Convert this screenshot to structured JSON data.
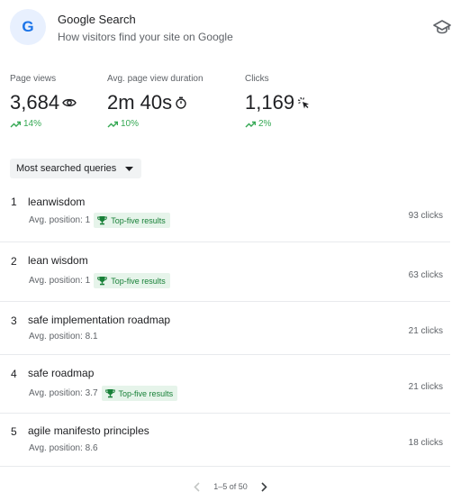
{
  "header": {
    "logo_letter": "G",
    "title": "Google Search",
    "subtitle": "How visitors find your site on Google",
    "learn_icon": "graduation-cap-icon"
  },
  "metrics": [
    {
      "label": "Page views",
      "value": "3,684",
      "icon": "eye-icon",
      "change": "14%",
      "trend": "up"
    },
    {
      "label": "Avg. page view duration",
      "value": "2m 40s",
      "icon": "timer-icon",
      "change": "10%",
      "trend": "up"
    },
    {
      "label": "Clicks",
      "value": "1,169",
      "icon": "click-icon",
      "change": "2%",
      "trend": "up"
    }
  ],
  "dropdown": {
    "selected": "Most searched queries"
  },
  "queries": [
    {
      "rank": "1",
      "query": "leanwisdom",
      "position": "Avg. position: 1",
      "badge": "Top-five results",
      "clicks": "93 clicks"
    },
    {
      "rank": "2",
      "query": "lean wisdom",
      "position": "Avg. position: 1",
      "badge": "Top-five results",
      "clicks": "63 clicks"
    },
    {
      "rank": "3",
      "query": "safe implementation roadmap",
      "position": "Avg. position: 8.1",
      "badge": "",
      "clicks": "21 clicks"
    },
    {
      "rank": "4",
      "query": "safe roadmap",
      "position": "Avg. position: 3.7",
      "badge": "Top-five results",
      "clicks": "21 clicks"
    },
    {
      "rank": "5",
      "query": "agile manifesto principles",
      "position": "Avg. position: 8.6",
      "badge": "",
      "clicks": "18 clicks"
    }
  ],
  "pagination": {
    "range": "1–5 of 50"
  },
  "colors": {
    "accent": "#1a73e8",
    "positive": "#34a853",
    "badge_bg": "#e6f4ea",
    "badge_text": "#188038"
  }
}
